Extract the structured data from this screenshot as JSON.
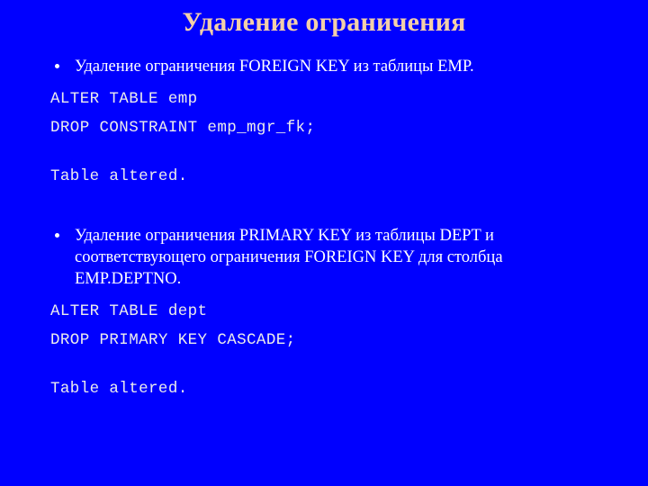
{
  "slide": {
    "background_color": "#0000FF",
    "title": "Удаление ограничения",
    "title_color": "#F3CFA9",
    "body_text_color": "#FFFFFF",
    "code_text_color": "#ECECEC",
    "blocks": {
      "bullet_1": "Удаление ограничения FOREIGN KEY из таблицы EMP.",
      "code_1_line_1": "ALTER TABLE emp",
      "code_1_line_2": "DROP CONSTRAINT emp_mgr_fk;",
      "result_1": "Table altered.",
      "bullet_2": "Удаление ограничения PRIMARY KEY из таблицы DEPT и соответствующего ограничения FOREIGN KEY для столбца EMP.DEPTNO.",
      "code_2_line_1": "ALTER TABLE dept",
      "code_2_line_2": "DROP PRIMARY KEY CASCADE;",
      "result_2": "Table altered."
    }
  }
}
